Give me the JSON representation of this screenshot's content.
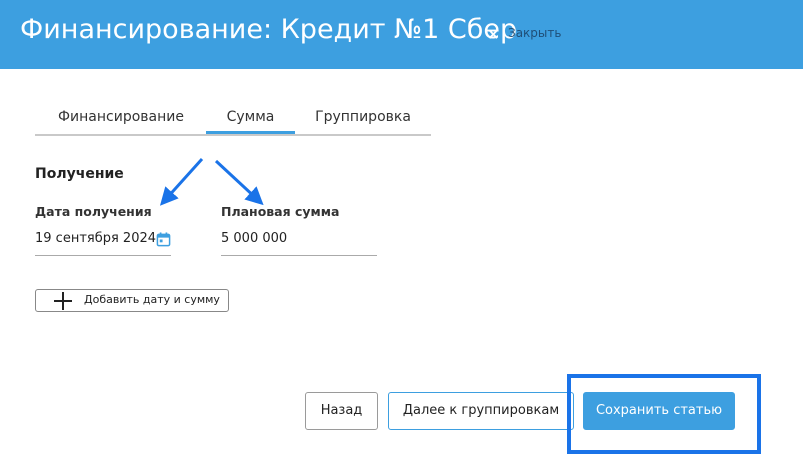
{
  "header": {
    "title": "Финансирование: Кредит №1 Сбер",
    "close_symbol": "×",
    "close_label": "Закрыть"
  },
  "tabs": [
    {
      "label": "Финансирование",
      "active": false
    },
    {
      "label": "Сумма",
      "active": true
    },
    {
      "label": "Группировка",
      "active": false
    }
  ],
  "section": {
    "title": "Получение",
    "date_label": "Дата получения",
    "date_value": "19 сентября 2024",
    "amount_label": "Плановая сумма",
    "amount_value": "5 000 000",
    "add_label": "Добавить дату и сумму"
  },
  "footer": {
    "back_label": "Назад",
    "next_label": "Далее к группировкам",
    "save_label": "Сохранить статью"
  },
  "icons": {
    "calendar": "calendar-icon",
    "plus": "plus-icon",
    "close": "close-icon"
  },
  "colors": {
    "header": "#3d9fe0",
    "accent": "#3d9fe0",
    "annotation": "#1a73e8"
  }
}
